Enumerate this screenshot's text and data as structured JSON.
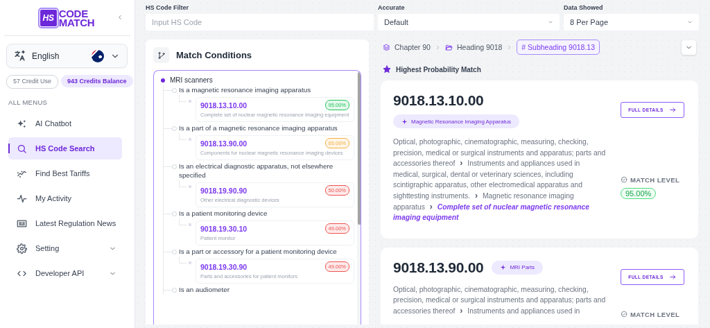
{
  "sidebar": {
    "logo": {
      "mark": "HS",
      "line1": "CODE",
      "line2": "MATCH"
    },
    "language": {
      "label": "English"
    },
    "credits": {
      "used": "57 Credit Use",
      "balance": "943 Credits Balance"
    },
    "section_title": "ALL MENUS",
    "items": [
      {
        "label": "AI Chatbot",
        "selected": false,
        "has_submenu": false
      },
      {
        "label": "HS Code Search",
        "selected": true,
        "has_submenu": false
      },
      {
        "label": "Find Best Tariffs",
        "selected": false,
        "has_submenu": false
      },
      {
        "label": "My Activity",
        "selected": false,
        "has_submenu": false
      },
      {
        "label": "Latest Regulation News",
        "selected": false,
        "has_submenu": false
      },
      {
        "label": "Setting",
        "selected": false,
        "has_submenu": true
      },
      {
        "label": "Developer API",
        "selected": false,
        "has_submenu": true
      }
    ]
  },
  "filters": [
    {
      "label": "HS Code Filter",
      "kind": "input",
      "placeholder": "Input HS Code"
    },
    {
      "label": "Accurate",
      "kind": "select",
      "value": "Default"
    },
    {
      "label": "Data Showed",
      "kind": "select",
      "value": "8 Per Page"
    }
  ],
  "match_conditions": {
    "title": "Match Conditions",
    "root": {
      "label": "MRI scanners",
      "children": [
        {
          "label": "Is a magnetic resonance imaging apparatus",
          "result": {
            "code": "9018.13.10.00",
            "description": "Complete set of nuclear magnetic resonance imaging equipment",
            "score": "95.00%",
            "color": "#22c55e"
          }
        },
        {
          "label": "Is a part of a magnetic resonance imaging apparatus",
          "result": {
            "code": "9018.13.90.00",
            "description": "Components for nuclear magnetic resonance imaging devices",
            "score": "65.00%",
            "color": "#f5b041"
          }
        },
        {
          "label": "Is an electrical diagnostic apparatus, not elsewhere specified",
          "result": {
            "code": "9018.19.90.90",
            "description": "Other electrical diagnostic devices",
            "score": "50.00%",
            "color": "#ef5350"
          }
        },
        {
          "label": "Is a patient monitoring device",
          "result": {
            "code": "9018.19.30.10",
            "description": "Patient monitor",
            "score": "49.00%",
            "color": "#ef5350"
          }
        },
        {
          "label": "Is a part or accessory for a patient monitoring device",
          "result": {
            "code": "9018.19.30.90",
            "description": "Parts and accessories for patient monitors",
            "score": "49.00%",
            "color": "#ef5350"
          }
        },
        {
          "label": "Is an audiometer"
        }
      ]
    }
  },
  "breadcrumb": [
    {
      "label": "Chapter 90",
      "selected": false
    },
    {
      "label": "Heading 9018",
      "selected": false
    },
    {
      "label": "# Subheading 9018.13",
      "selected": true
    }
  ],
  "results_title": "Highest Probability Match",
  "results": [
    {
      "code": "9018.13.10.00",
      "tag": "Magnetic Resonance Imaging Apparatus",
      "path": [
        "Optical, photographic, cinematographic, measuring, checking, precision, medical or surgical instruments and apparatus; parts and accessories thereof",
        "Instruments and appliances used in medical, surgical, dental or veterinary sciences, including scintigraphic apparatus, other electromedical apparatus and sighttesting instruments.",
        "Magnetic resonance imaging apparatus"
      ],
      "match": "Complete set of nuclear magnetic resonance imaging equipment",
      "separator": "›",
      "button": "FULL DETAILS",
      "match_level_label": "MATCH LEVEL",
      "match_level": "95.00%"
    },
    {
      "code": "9018.13.90.00",
      "tag": "MRI Parts",
      "path": [
        "Optical, photographic, cinematographic, measuring, checking, precision, medical or surgical instruments and apparatus; parts and accessories thereof",
        "Instruments and appliances used in"
      ],
      "separator": "›",
      "button": "FULL DETAILS",
      "match_level_label": "MATCH LEVEL"
    }
  ]
}
